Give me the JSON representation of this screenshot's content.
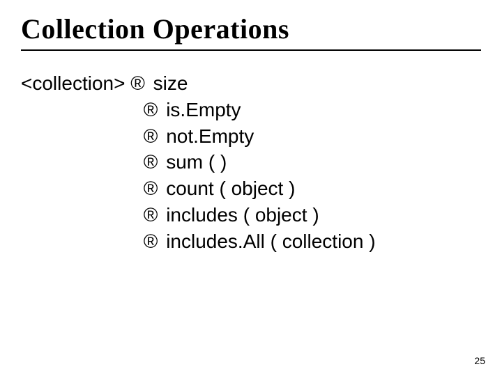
{
  "title": "Collection Operations",
  "lead": "<collection>",
  "arrow": "®",
  "ops": {
    "o0": "size",
    "o1": "is.Empty",
    "o2": "not.Empty",
    "o3": "sum ( )",
    "o4": "count ( object )",
    "o5": "includes ( object )",
    "o6": "includes.All ( collection )"
  },
  "page": "25"
}
